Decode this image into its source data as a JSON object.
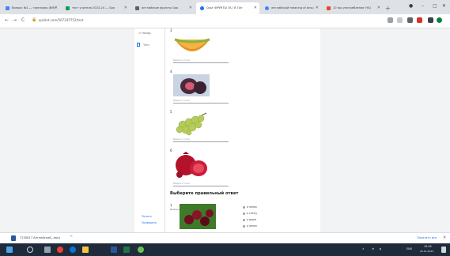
{
  "browser": {
    "tabs": [
      {
        "label": "Вопрос №1 — тренажер (ВМ)",
        "favicon_color": "#4285f4"
      },
      {
        "label": "тест учителя 2023-24 — Goo",
        "favicon_color": "#0f9d58"
      },
      {
        "label": "английские фрукты Goo",
        "favicon_color": "#5f6368"
      },
      {
        "label": "Quiz: ФРУКТЫ 7А / B Гоп",
        "favicon_color": "#1a73e8"
      },
      {
        "label": "английский meaning of ansu",
        "favicon_color": "#4285f4"
      },
      {
        "label": "10 top употребление (YA)",
        "favicon_color": "#ea4335"
      }
    ],
    "new_tab": "+",
    "window_controls": [
      "–",
      "▢",
      "✕"
    ],
    "url": "quizlet.com/567245752/test",
    "nav": [
      "←",
      "→",
      "C"
    ]
  },
  "sidebar": {
    "back_label": "< Назад",
    "items": [
      "Тест"
    ],
    "links": [
      "Печать",
      "Проверить"
    ]
  },
  "quiz": {
    "questions": [
      {
        "number": "3",
        "caption": "Введите ответ",
        "image": "melon"
      },
      {
        "number": "4",
        "caption": "Введите ответ",
        "image": "fig"
      },
      {
        "number": "5",
        "caption": "Введите ответ",
        "image": "grapes"
      },
      {
        "number": "6",
        "caption": "Введите ответ",
        "image": "pomegranate"
      }
    ],
    "section_title": "Выберите правильный ответ",
    "mc_question": {
      "number": "7",
      "caption": "Выбери",
      "image": "cherries",
      "options": [
        "a melon",
        "a cherry",
        "a grape",
        "a lemon"
      ]
    }
  },
  "download": {
    "filename": "7230817 Английский_.docx",
    "show_all": "Показать все"
  },
  "taskbar": {
    "time": "19:45",
    "date": "20.01.2024",
    "lang": "ENG"
  }
}
